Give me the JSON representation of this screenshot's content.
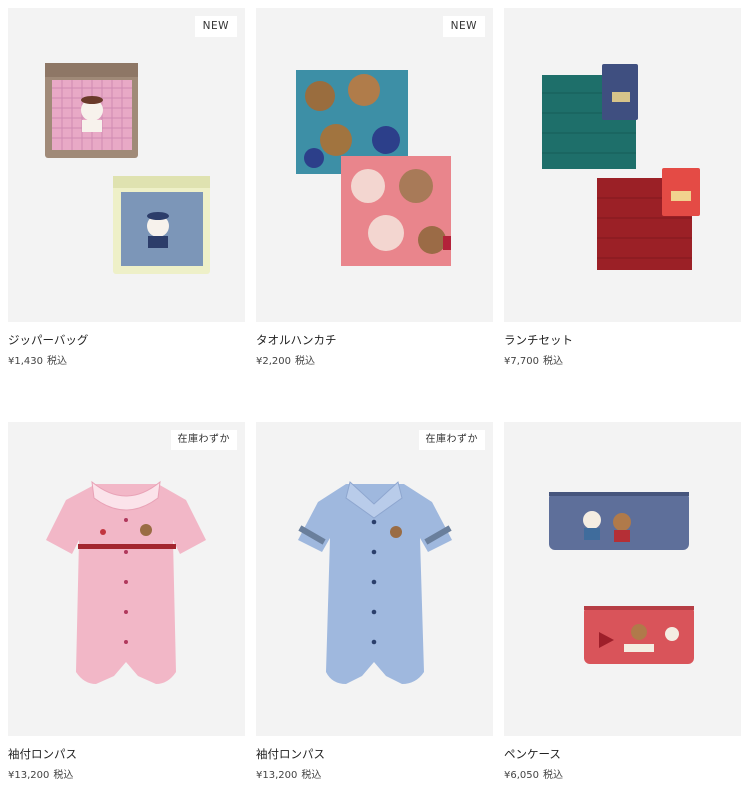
{
  "products": [
    {
      "name": "ジッパーバッグ",
      "price": "¥1,430",
      "tax": "税込",
      "badge": "NEW",
      "image_icon": "zipper-bag-image"
    },
    {
      "name": "タオルハンカチ",
      "price": "¥2,200",
      "tax": "税込",
      "badge": "NEW",
      "image_icon": "towel-handkerchief-image"
    },
    {
      "name": "ランチセット",
      "price": "¥7,700",
      "tax": "税込",
      "badge": "",
      "image_icon": "lunch-set-image"
    },
    {
      "name": "袖付ロンパス",
      "price": "¥13,200",
      "tax": "税込",
      "badge": "在庫わずか",
      "image_icon": "pink-romper-image"
    },
    {
      "name": "袖付ロンパス",
      "price": "¥13,200",
      "tax": "税込",
      "badge": "在庫わずか",
      "image_icon": "blue-romper-image"
    },
    {
      "name": "ペンケース",
      "price": "¥6,050",
      "tax": "税込",
      "badge": "",
      "image_icon": "pen-case-image"
    }
  ],
  "colors": {
    "card_background": "#f3f3f3",
    "badge_background": "#ffffff",
    "text": "#222222"
  }
}
